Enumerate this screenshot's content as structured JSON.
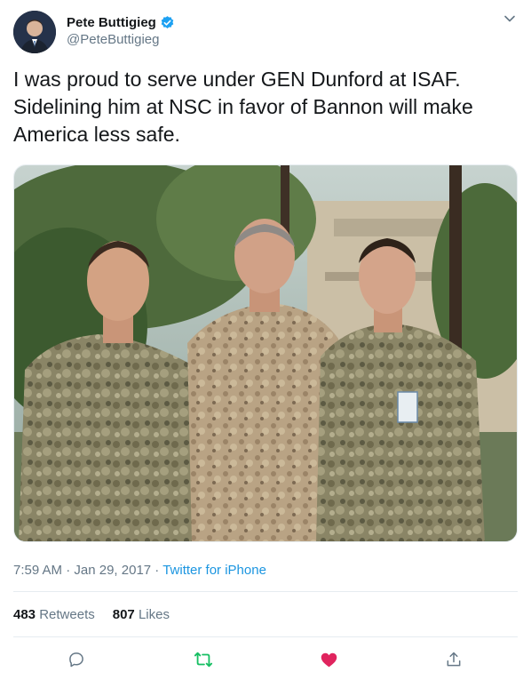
{
  "author": {
    "display_name": "Pete Buttigieg",
    "handle": "@PeteButtigieg",
    "verified_icon": "verified-badge-icon",
    "verified_color": "#1da1f2"
  },
  "tweet": {
    "text": "I was proud to serve under GEN Dunford at ISAF.\nSidelining him at NSC in favor of Bannon will make\nAmerica less safe."
  },
  "meta": {
    "time": "7:59 AM",
    "date": "Jan 29, 2017",
    "separator": " · ",
    "source": "Twitter for iPhone"
  },
  "stats": {
    "retweets_count": "483",
    "retweets_label": "Retweets",
    "likes_count": "807",
    "likes_label": "Likes"
  },
  "actions": {
    "reply_icon": "reply-icon",
    "retweet_icon": "retweet-icon",
    "like_icon": "heart-icon",
    "share_icon": "share-icon",
    "retweet_color": "#17bf63",
    "like_color": "#e0245e"
  }
}
